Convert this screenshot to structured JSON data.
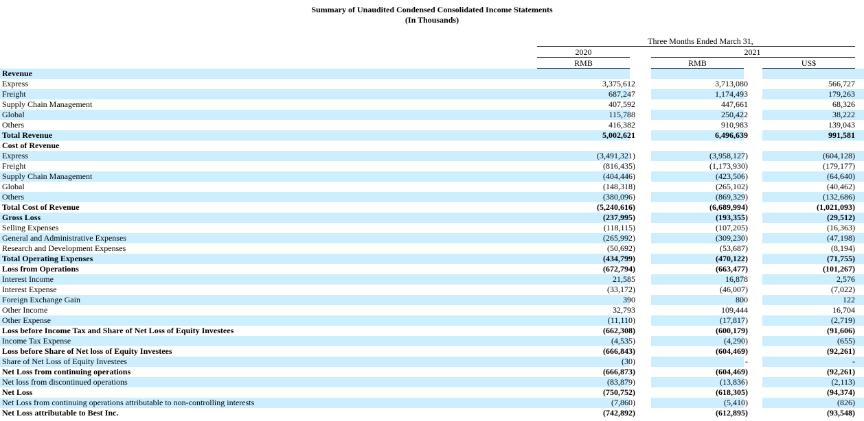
{
  "header": {
    "title": "Summary of Unaudited Condensed Consolidated Income Statements",
    "subtitle": "(In Thousands)",
    "period": "Three Months Ended March 31,",
    "year_2020": "2020",
    "year_2021": "2021",
    "cur_2020": "RMB",
    "cur_2021_rmb": "RMB",
    "cur_2021_usd": "US$"
  },
  "rows": [
    {
      "label": "Revenue",
      "v": [
        "",
        "",
        ""
      ],
      "bold": true,
      "shade": true
    },
    {
      "label": "Express",
      "v": [
        "3,375,612",
        "3,713,080",
        "566,727"
      ],
      "bold": false,
      "shade": false
    },
    {
      "label": "Freight",
      "v": [
        "687,247",
        "1,174,493",
        "179,263"
      ],
      "bold": false,
      "shade": true
    },
    {
      "label": "Supply Chain Management",
      "v": [
        "407,592",
        "447,661",
        "68,326"
      ],
      "bold": false,
      "shade": false
    },
    {
      "label": "Global",
      "v": [
        "115,788",
        "250,422",
        "38,222"
      ],
      "bold": false,
      "shade": true
    },
    {
      "label": "Others",
      "v": [
        "416,382",
        "910,983",
        "139,043"
      ],
      "bold": false,
      "shade": false
    },
    {
      "label": "Total Revenue",
      "v": [
        "5,002,621",
        "6,496,639",
        "991,581"
      ],
      "bold": true,
      "shade": true
    },
    {
      "label": "Cost of Revenue",
      "v": [
        "",
        "",
        ""
      ],
      "bold": true,
      "shade": false
    },
    {
      "label": "Express",
      "v": [
        "(3,491,321)",
        "(3,958,127)",
        "(604,128)"
      ],
      "bold": false,
      "shade": true
    },
    {
      "label": "Freight",
      "v": [
        "(816,435)",
        "(1,173,930)",
        "(179,177)"
      ],
      "bold": false,
      "shade": false
    },
    {
      "label": "Supply Chain Management",
      "v": [
        "(404,446)",
        "(423,506)",
        "(64,640)"
      ],
      "bold": false,
      "shade": true
    },
    {
      "label": "Global",
      "v": [
        "(148,318)",
        "(265,102)",
        "(40,462)"
      ],
      "bold": false,
      "shade": false
    },
    {
      "label": "Others",
      "v": [
        "(380,096)",
        "(869,329)",
        "(132,686)"
      ],
      "bold": false,
      "shade": true
    },
    {
      "label": "Total Cost of Revenue",
      "v": [
        "(5,240,616)",
        "(6,689,994)",
        "(1,021,093)"
      ],
      "bold": true,
      "shade": false
    },
    {
      "label": "Gross Loss",
      "v": [
        "(237,995)",
        "(193,355)",
        "(29,512)"
      ],
      "bold": true,
      "shade": true
    },
    {
      "label": "Selling Expenses",
      "v": [
        "(118,115)",
        "(107,205)",
        "(16,363)"
      ],
      "bold": false,
      "shade": false
    },
    {
      "label": "General and Administrative Expenses",
      "v": [
        "(265,992)",
        "(309,230)",
        "(47,198)"
      ],
      "bold": false,
      "shade": true
    },
    {
      "label": "Research and  Development Expenses",
      "v": [
        "(50,692)",
        "(53,687)",
        "(8,194)"
      ],
      "bold": false,
      "shade": false
    },
    {
      "label": "Total Operating Expenses",
      "v": [
        "(434,799)",
        "(470,122)",
        "(71,755)"
      ],
      "bold": true,
      "shade": true
    },
    {
      "label": "Loss from Operations",
      "v": [
        "(672,794)",
        "(663,477)",
        "(101,267)"
      ],
      "bold": true,
      "shade": false
    },
    {
      "label": "Interest Income",
      "v": [
        "21,585",
        "16,878",
        "2,576"
      ],
      "bold": false,
      "shade": true
    },
    {
      "label": "Interest Expense",
      "v": [
        "(33,172)",
        "(46,007)",
        "(7,022)"
      ],
      "bold": false,
      "shade": false
    },
    {
      "label": "Foreign Exchange Gain",
      "v": [
        "390",
        "800",
        "122"
      ],
      "bold": false,
      "shade": true
    },
    {
      "label": "Other Income",
      "v": [
        "32,793",
        "109,444",
        "16,704"
      ],
      "bold": false,
      "shade": false
    },
    {
      "label": "Other Expense",
      "v": [
        "(11,110)",
        "(17,817)",
        "(2,719)"
      ],
      "bold": false,
      "shade": true
    },
    {
      "label": "Loss before Income Tax and Share of Net Loss of Equity Investees",
      "v": [
        "(662,308)",
        "(600,179)",
        "(91,606)"
      ],
      "bold": true,
      "shade": false
    },
    {
      "label": "Income Tax Expense",
      "v": [
        "(4,535)",
        "(4,290)",
        "(655)"
      ],
      "bold": false,
      "shade": true
    },
    {
      "label": "Loss before Share of Net loss of Equity Investees",
      "v": [
        "(666,843)",
        "(604,469)",
        "(92,261)"
      ],
      "bold": true,
      "shade": false
    },
    {
      "label": "Share of Net Loss of Equity Investees",
      "v": [
        "(30)",
        "-",
        "-"
      ],
      "bold": false,
      "shade": true
    },
    {
      "label": "Net Loss from continuing operations",
      "v": [
        "(666,873)",
        "(604,469)",
        "(92,261)"
      ],
      "bold": true,
      "shade": false
    },
    {
      "label": "Net loss from discontinued operations",
      "v": [
        "(83,879)",
        "(13,836)",
        "(2,113)"
      ],
      "bold": false,
      "shade": true
    },
    {
      "label": "Net Loss",
      "v": [
        "(750,752)",
        "(618,305)",
        "(94,374)"
      ],
      "bold": true,
      "shade": false
    },
    {
      "label": "Net Loss from continuing operations attributable to non-controlling interests",
      "v": [
        "(7,860)",
        "(5,410)",
        "(826)"
      ],
      "bold": false,
      "shade": true
    },
    {
      "label": "Net Loss attributable to Best Inc.",
      "v": [
        "(742,892)",
        "(612,895)",
        "(93,548)"
      ],
      "bold": true,
      "shade": false
    }
  ]
}
